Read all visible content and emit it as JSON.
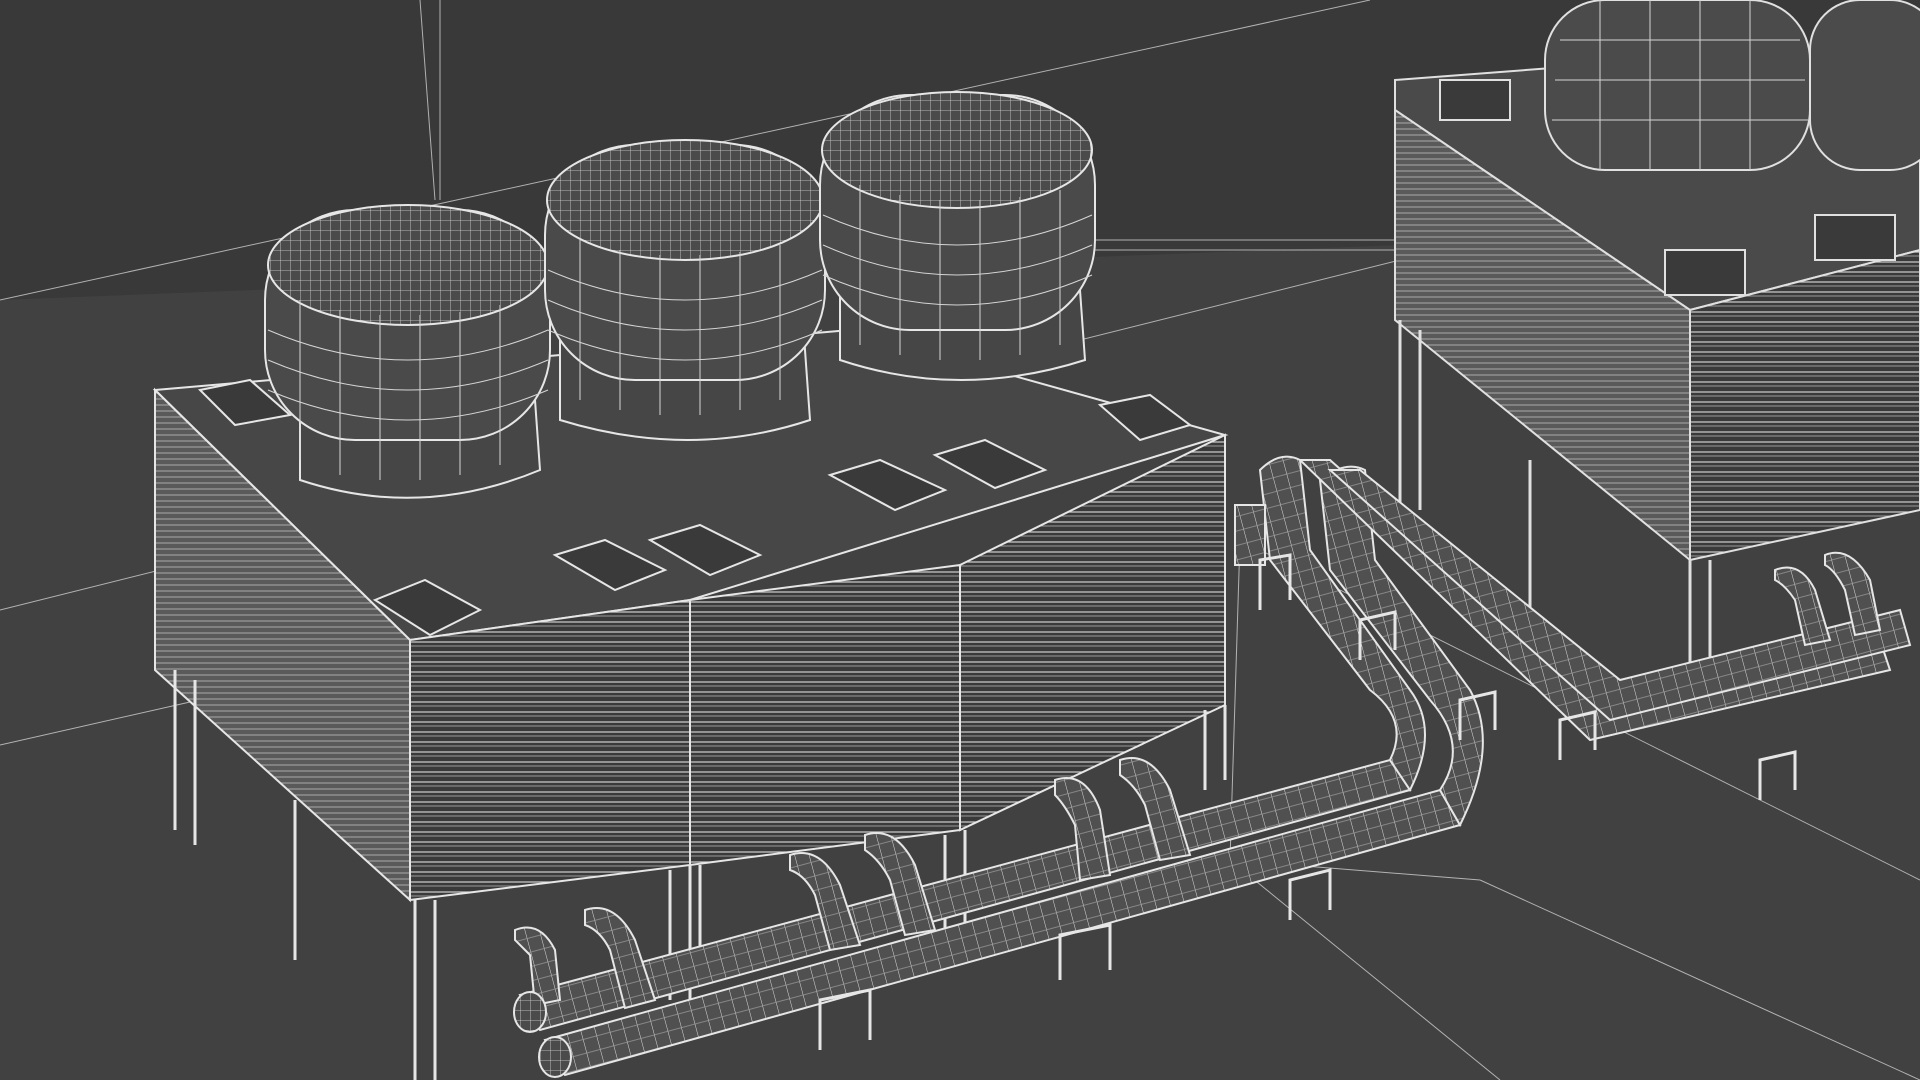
{
  "scene": {
    "background_color": "#3c3c3c",
    "floor_color": "#404040",
    "wall_color": "#393939",
    "wire_color": "#e6e6e6",
    "panel_fill": "#4a4a4a",
    "panel_fill_dark": "#333333",
    "units_front": 3,
    "units_back_visible": 2,
    "objects": [
      "wireframe-cooling-tower-unit-left",
      "wireframe-cooling-tower-unit-middle",
      "wireframe-cooling-tower-unit-right",
      "wireframe-cooling-tower-unit-background",
      "wireframe-pipe-manifold",
      "wireframe-pipe-supports"
    ]
  }
}
